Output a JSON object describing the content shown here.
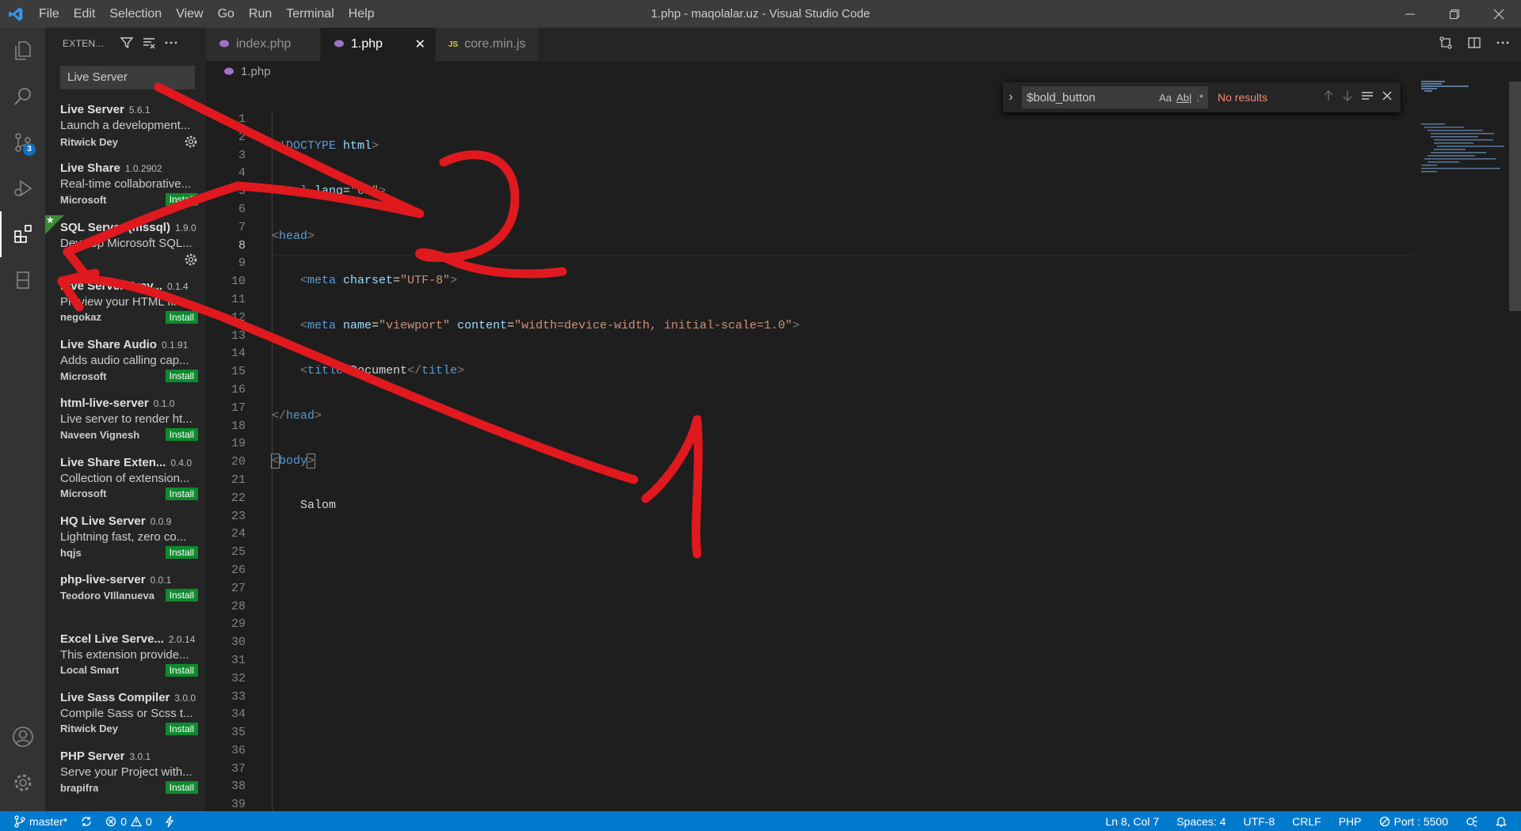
{
  "window": {
    "title": "1.php - maqolalar.uz - Visual Studio Code"
  },
  "menu": [
    "File",
    "Edit",
    "Selection",
    "View",
    "Go",
    "Run",
    "Terminal",
    "Help"
  ],
  "activity": {
    "source_control_badge": "3"
  },
  "sidebar": {
    "title": "EXTEN...",
    "search_value": "Live Server",
    "install_label": "Install",
    "extensions": [
      {
        "name": "Live Server",
        "version": "5.6.1",
        "desc": "Launch a development...",
        "publisher": "Ritwick Dey",
        "action": "gear"
      },
      {
        "name": "Live Share",
        "version": "1.0.2902",
        "desc": "Real-time collaborative...",
        "publisher": "Microsoft",
        "action": "install"
      },
      {
        "name": "SQL Server (mssql)",
        "version": "1.9.0",
        "desc": "Develop Microsoft SQL...",
        "publisher": "",
        "action": "gear",
        "starred": true
      },
      {
        "name": "Live Server Prev...",
        "version": "0.1.4",
        "desc": "Preview your HTML file...",
        "publisher": "negokaz",
        "action": "install"
      },
      {
        "name": "Live Share Audio",
        "version": "0.1.91",
        "desc": "Adds audio calling cap...",
        "publisher": "Microsoft",
        "action": "install"
      },
      {
        "name": "html-live-server",
        "version": "0.1.0",
        "desc": "Live server to render ht...",
        "publisher": "Naveen Vignesh",
        "action": "install"
      },
      {
        "name": "Live Share Exten...",
        "version": "0.4.0",
        "desc": "Collection of extension...",
        "publisher": "Microsoft",
        "action": "install"
      },
      {
        "name": "HQ Live Server",
        "version": "0.0.9",
        "desc": "Lightning fast, zero co...",
        "publisher": "hqjs",
        "action": "install"
      },
      {
        "name": "php-live-server",
        "version": "0.0.1",
        "desc": "",
        "publisher": "Teodoro VIllanueva",
        "action": "install"
      },
      {
        "name": "Excel Live Serve...",
        "version": "2.0.14",
        "desc": "This extension provide...",
        "publisher": "Local Smart",
        "action": "install"
      },
      {
        "name": "Live Sass Compiler",
        "version": "3.0.0",
        "desc": "Compile Sass or Scss t...",
        "publisher": "Ritwick Dey",
        "action": "install"
      },
      {
        "name": "PHP Server",
        "version": "3.0.1",
        "desc": "Serve your Project with...",
        "publisher": "brapifra",
        "action": "install"
      }
    ]
  },
  "tabs": [
    {
      "label": "index.php",
      "icon": "php-elephant-icon",
      "active": false
    },
    {
      "label": "1.php",
      "icon": "php-elephant-icon",
      "active": true
    },
    {
      "label": "core.min.js",
      "icon": "js-icon",
      "active": false
    }
  ],
  "breadcrumb": "1.php",
  "find": {
    "value": "$bold_button",
    "opt_case": "Aa",
    "opt_word": "Ab|",
    "opt_regex": ".*",
    "status": "No results"
  },
  "gutter": [
    "1",
    "2",
    "3",
    "4",
    "5",
    "6",
    "7",
    "8",
    "9",
    "10",
    "11",
    "12",
    "13",
    "14",
    "15",
    "16",
    "17",
    "18",
    "19",
    "20",
    "21",
    "22",
    "23",
    "24",
    "25",
    "26",
    "27",
    "28",
    "29",
    "30",
    "31",
    "32",
    "33",
    "34",
    "35",
    "36",
    "37",
    "38",
    "39"
  ],
  "code": {
    "l1_a": "<!",
    "l1_b": "DOCTYPE",
    "l1_c": " html",
    "l1_d": ">",
    "l2_a": "<",
    "l2_b": "html",
    "l2_c": " lang",
    "l2_d": "=",
    "l2_e": "\"en\"",
    "l2_f": ">",
    "l3_a": "<",
    "l3_b": "head",
    "l3_c": ">",
    "l4_a": "<",
    "l4_b": "meta",
    "l4_c": " charset",
    "l4_d": "=",
    "l4_e": "\"UTF-8\"",
    "l4_f": ">",
    "l5_a": "<",
    "l5_b": "meta",
    "l5_c": " name",
    "l5_d": "=",
    "l5_e": "\"viewport\"",
    "l5_f": " content",
    "l5_g": "=",
    "l5_h": "\"width=device-width, initial-scale=1.0\"",
    "l5_i": ">",
    "l6_a": "<",
    "l6_b": "title",
    "l6_c": ">",
    "l6_d": "Document",
    "l6_e": "</",
    "l6_f": "title",
    "l6_g": ">",
    "l7_a": "</",
    "l7_b": "head",
    "l7_c": ">",
    "l8_a": "<",
    "l8_b": "body",
    "l8_c": ">",
    "l9": "Salom"
  },
  "status": {
    "branch": "master*",
    "errors": "0",
    "warnings": "0",
    "position": "Ln 8, Col 7",
    "spaces": "Spaces: 4",
    "encoding": "UTF-8",
    "eol": "CRLF",
    "language": "PHP",
    "port": "Port : 5500"
  },
  "annotations": {
    "label_1": "1",
    "label_2": "2",
    "color": "#e0191e"
  },
  "colors": {
    "accent": "#007acc",
    "install": "#0e8a2e",
    "activity_bar": "#333333"
  }
}
